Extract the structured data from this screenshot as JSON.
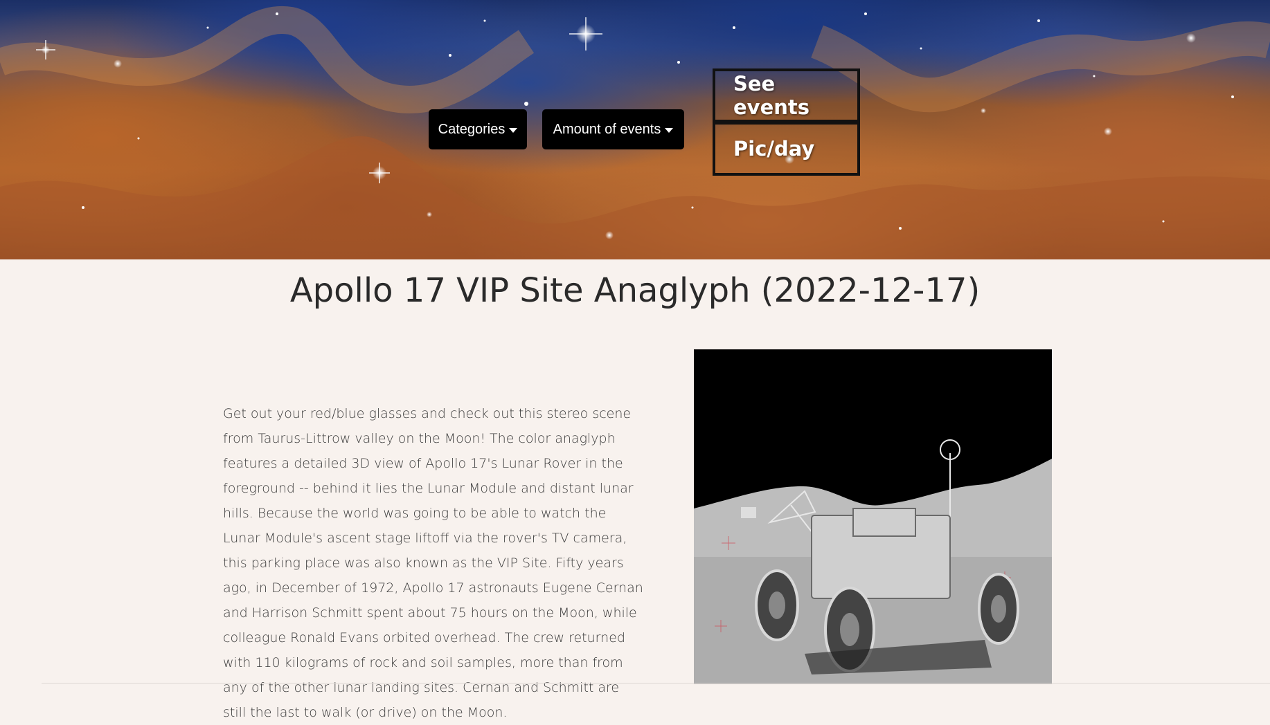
{
  "nav": {
    "categories_label": "Categories",
    "amount_label": "Amount of events",
    "see_events_label": "See events",
    "pic_day_label": "Pic/day"
  },
  "apod": {
    "title": "Apollo 17 VIP Site Anaglyph (2022-12-17)",
    "explanation": "Get out your red/blue glasses and check out this stereo scene from Taurus-Littrow valley on the Moon! The color anaglyph features a detailed 3D view of Apollo 17's Lunar Rover in the foreground -- behind it lies the Lunar Module and distant lunar hills. Because the world was going to be able to watch the Lunar Module's ascent stage liftoff via the rover's TV camera, this parking place was also known as the VIP Site. Fifty years ago, in December of 1972, Apollo 17 astronauts Eugene Cernan and Harrison Schmitt spent about 75 hours on the Moon, while colleague Ronald Evans orbited overhead. The crew returned with 110 kilograms of rock and soil samples, more than from any of the other lunar landing sites. Cernan and Schmitt are still the last to walk (or drive) on the Moon."
  },
  "colors": {
    "page_background": "#f8f2ee",
    "button_background": "#000000",
    "button_text": "#ffffff",
    "title_text": "#2a2a2a",
    "body_text": "#3c3c3c"
  },
  "icons": {
    "dropdown": "caret-down-icon"
  }
}
